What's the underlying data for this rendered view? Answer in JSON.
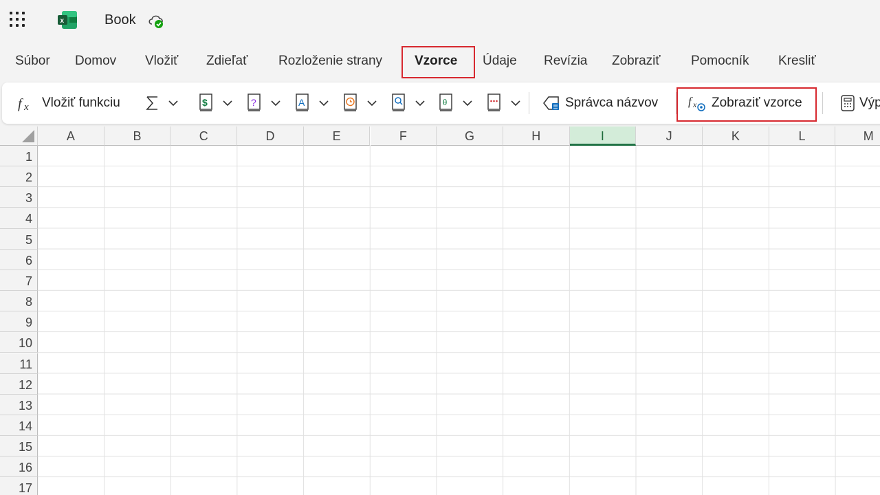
{
  "app": {
    "document_title": "Book",
    "logo_icon": "excel-logo-icon",
    "menu_icon": "app-launcher-icon",
    "save_status_icon": "cloud-saved-icon"
  },
  "tabs": [
    {
      "label": "Súbor"
    },
    {
      "label": "Domov"
    },
    {
      "label": "Vložiť"
    },
    {
      "label": "Zdieľať"
    },
    {
      "label": "Rozloženie strany"
    },
    {
      "label": "Vzorce",
      "active": true
    },
    {
      "label": "Údaje"
    },
    {
      "label": "Revízia"
    },
    {
      "label": "Zobraziť"
    },
    {
      "label": "Pomocník"
    },
    {
      "label": "Kresliť"
    }
  ],
  "ribbon": {
    "insert_function": "Vložiť funkciu",
    "name_manager": "Správca názvov",
    "show_formulas": "Zobraziť vzorce",
    "calculation": "Výp",
    "groups": [
      "autosum",
      "financial",
      "logical",
      "text",
      "date-time",
      "lookup",
      "math",
      "more-functions"
    ]
  },
  "sheet": {
    "columns": [
      "A",
      "B",
      "C",
      "D",
      "E",
      "F",
      "G",
      "H",
      "I",
      "J",
      "K",
      "L",
      "M"
    ],
    "selected_column": "I",
    "rows": [
      "1",
      "2",
      "3",
      "4",
      "5",
      "6",
      "7",
      "8",
      "9",
      "10",
      "11",
      "12",
      "13",
      "14",
      "15",
      "16",
      "17"
    ]
  },
  "colors": {
    "accent": "#217346",
    "highlight": "#d7282f",
    "selected_header_bg": "#d3ecd9"
  }
}
